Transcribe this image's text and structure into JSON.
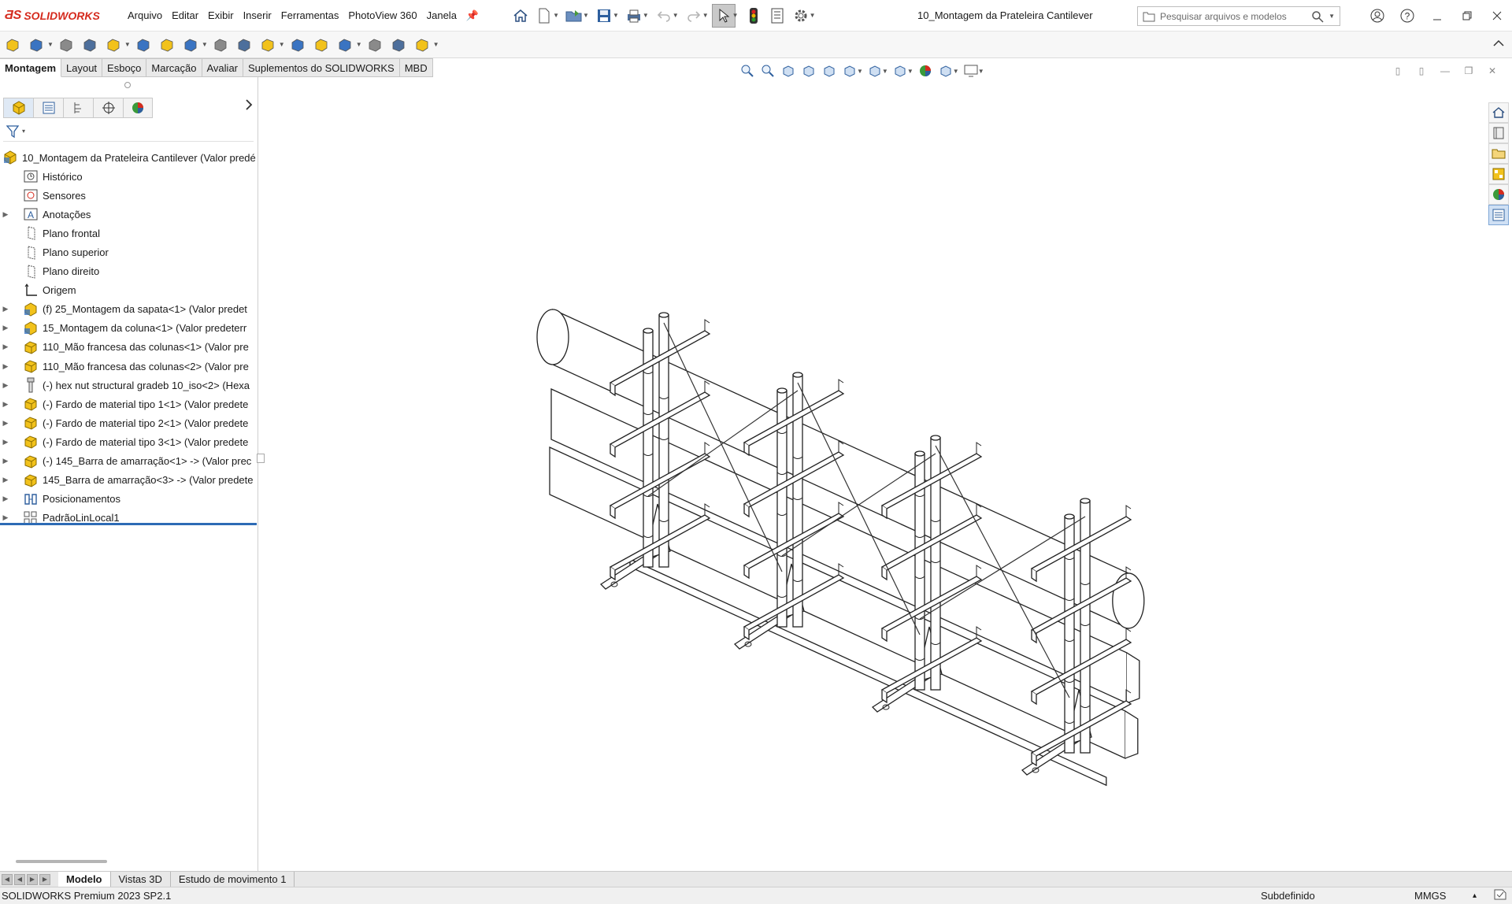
{
  "app": {
    "brand": "SOLIDWORKS",
    "document_title": "10_Montagem da Prateleira Cantilever"
  },
  "menu": [
    "Arquivo",
    "Editar",
    "Exibir",
    "Inserir",
    "Ferramentas",
    "PhotoView 360",
    "Janela"
  ],
  "search": {
    "placeholder": "Pesquisar arquivos e modelos"
  },
  "tabs": [
    "Montagem",
    "Layout",
    "Esboço",
    "Marcação",
    "Avaliar",
    "Suplementos do SOLIDWORKS",
    "MBD"
  ],
  "tree": {
    "root": "10_Montagem da Prateleira Cantilever (Valor predé",
    "items": [
      {
        "label": "Histórico",
        "icon": "history-icon",
        "expandable": false
      },
      {
        "label": "Sensores",
        "icon": "sensor-icon",
        "expandable": false
      },
      {
        "label": "Anotações",
        "icon": "annotation-icon",
        "expandable": true
      },
      {
        "label": "Plano frontal",
        "icon": "plane-icon",
        "expandable": false
      },
      {
        "label": "Plano superior",
        "icon": "plane-icon",
        "expandable": false
      },
      {
        "label": "Plano direito",
        "icon": "plane-icon",
        "expandable": false
      },
      {
        "label": "Origem",
        "icon": "origin-icon",
        "expandable": false
      },
      {
        "label": "(f) 25_Montagem da sapata<1> (Valor predet",
        "icon": "subassembly-icon",
        "expandable": true
      },
      {
        "label": "15_Montagem da coluna<1> (Valor predeterr",
        "icon": "subassembly-icon",
        "expandable": true
      },
      {
        "label": "110_Mão francesa das colunas<1> (Valor pre",
        "icon": "part-icon",
        "expandable": true
      },
      {
        "label": "110_Mão francesa das colunas<2> (Valor pre",
        "icon": "part-icon",
        "expandable": true
      },
      {
        "label": "(-) hex nut structural gradeb 10_iso<2> (Hexa",
        "icon": "bolt-icon",
        "expandable": true
      },
      {
        "label": "(-) Fardo de material tipo 1<1> (Valor predete",
        "icon": "part-icon",
        "expandable": true
      },
      {
        "label": "(-) Fardo de material tipo 2<1> (Valor predete",
        "icon": "part-icon",
        "expandable": true
      },
      {
        "label": "(-) Fardo de material tipo 3<1> (Valor predete",
        "icon": "part-icon",
        "expandable": true
      },
      {
        "label": "(-) 145_Barra de amarração<1> -> (Valor prec",
        "icon": "part-icon",
        "expandable": true
      },
      {
        "label": "145_Barra de amarração<3> -> (Valor predete",
        "icon": "part-icon",
        "expandable": true
      },
      {
        "label": "Posicionamentos",
        "icon": "mates-icon",
        "expandable": true
      },
      {
        "label": "PadrãoLinLocal1",
        "icon": "pattern-icon",
        "expandable": true
      }
    ]
  },
  "bottom_tabs": [
    "Modelo",
    "Vistas 3D",
    "Estudo de movimento 1"
  ],
  "status": {
    "app_version": "SOLIDWORKS Premium 2023 SP2.1",
    "state": "Subdefinido",
    "units": "MMGS"
  },
  "colors": {
    "brand_red": "#d52b1e",
    "tree_accent": "#2d6bb5",
    "part_yellow": "#f2c21b",
    "assembly_blue": "#3a74c2"
  }
}
